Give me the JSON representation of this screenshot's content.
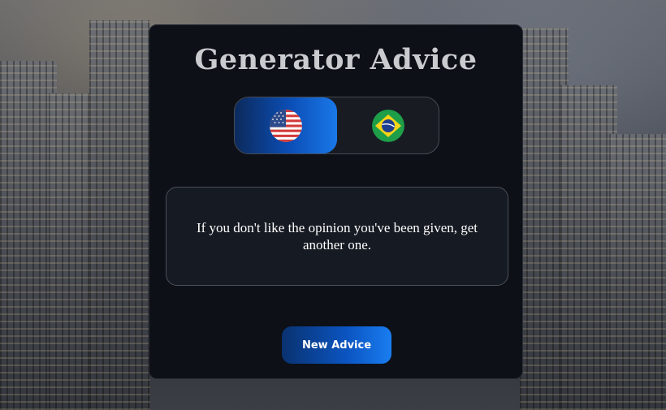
{
  "app": {
    "title": "Generator Advice"
  },
  "language": {
    "options": [
      {
        "code": "en",
        "icon": "us-flag-icon",
        "selected": true
      },
      {
        "code": "pt",
        "icon": "brazil-flag-icon",
        "selected": false
      }
    ]
  },
  "advice": {
    "text": "If you don't like the opinion you've been given, get another one."
  },
  "actions": {
    "new_advice_label": "New Advice"
  },
  "colors": {
    "card_bg": "#0d1017",
    "accent_start": "#0a3270",
    "accent_end": "#1a7df0",
    "title": "#c9cbcf"
  }
}
